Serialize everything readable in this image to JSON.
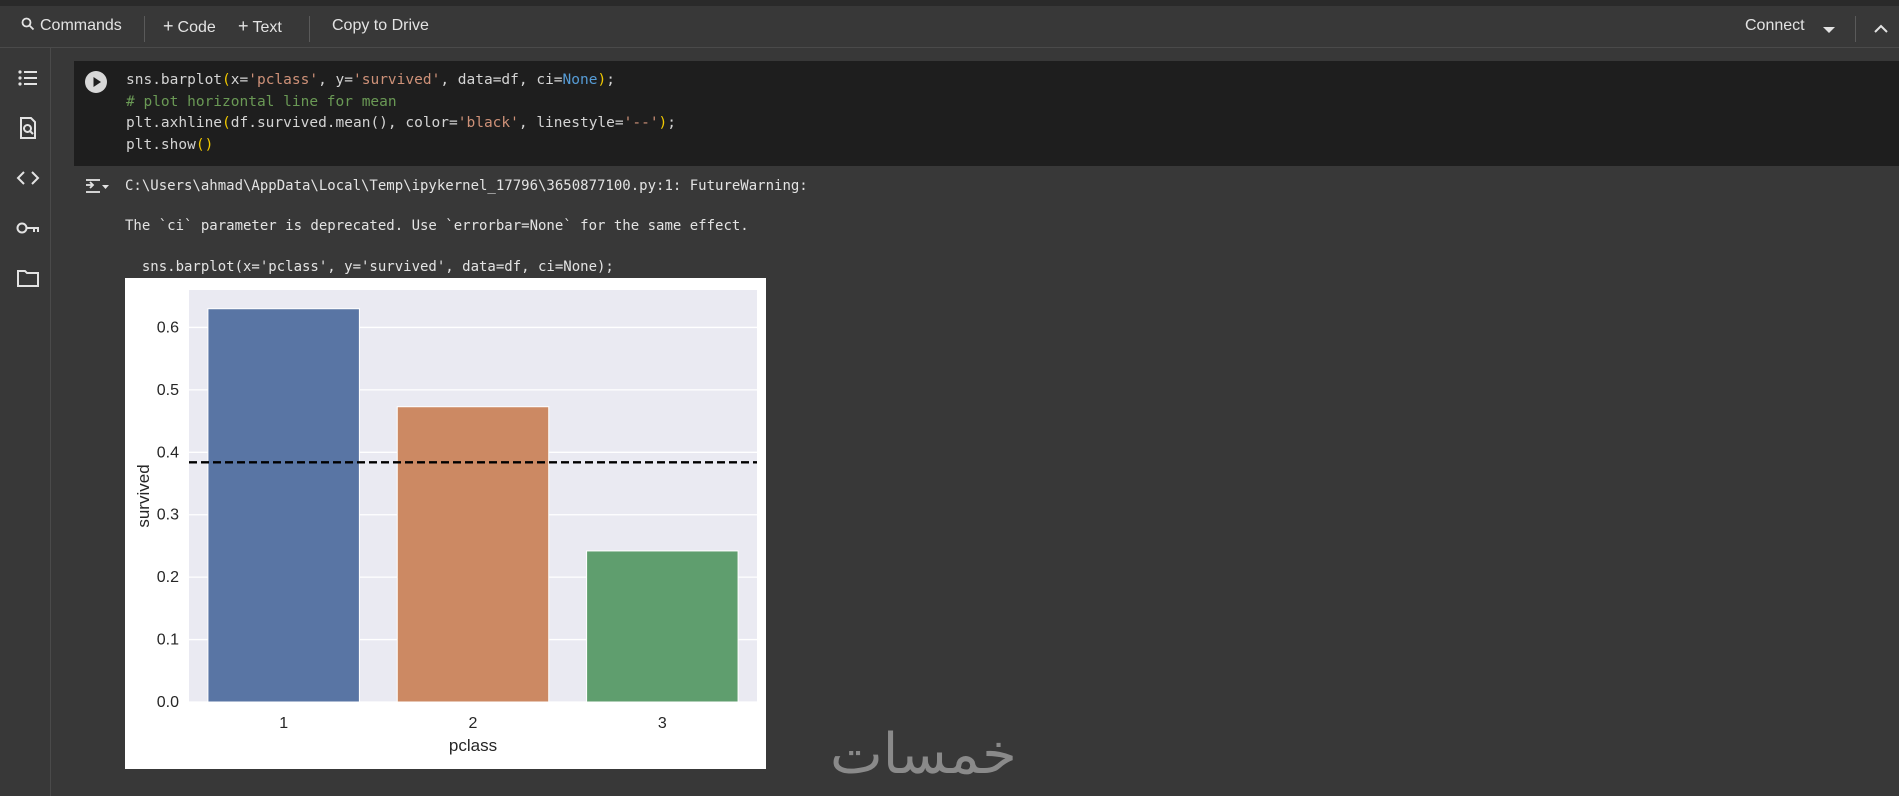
{
  "toolbar": {
    "commands_label": "Commands",
    "code_label": "Code",
    "text_label": "Text",
    "copy_label": "Copy to Drive",
    "connect_label": "Connect"
  },
  "cell": {
    "line1": {
      "a": "sns.barplot",
      "b": "(",
      "c": "x=",
      "d": "'pclass'",
      "e": ", y=",
      "f": "'survived'",
      "g": ", data=df, ci=",
      "h": "None",
      "i": ")",
      "j": ";"
    },
    "line2": "# plot horizontal line for mean",
    "line3": {
      "a": "plt.axhline",
      "b": "(",
      "c": "df.survived.mean(), color=",
      "d": "'black'",
      "e": ", linestyle=",
      "f": "'--'",
      "g": ")",
      "h": ";"
    },
    "line4": {
      "a": "plt.show",
      "b": "()"
    }
  },
  "output": {
    "warning_path": "C:\\Users\\ahmad\\AppData\\Local\\Temp\\ipykernel_17796\\3650877100.py:1: FutureWarning:",
    "warning_msg": "The `ci` parameter is deprecated. Use `errorbar=None` for the same effect.",
    "warning_code": "  sns.barplot(x='pclass', y='survived', data=df, ci=None);"
  },
  "chart_data": {
    "type": "bar",
    "categories": [
      "1",
      "2",
      "3"
    ],
    "values": [
      0.63,
      0.473,
      0.242
    ],
    "colors": [
      "#5975a4",
      "#cc8963",
      "#5f9e6e"
    ],
    "hline": 0.384,
    "hline_style": "dashed black",
    "xlabel": "pclass",
    "ylabel": "survived",
    "ylim": [
      0,
      0.66
    ],
    "yticks": [
      "0.0",
      "0.1",
      "0.2",
      "0.3",
      "0.4",
      "0.5",
      "0.6"
    ],
    "ytick_values": [
      0,
      0.1,
      0.2,
      0.3,
      0.4,
      0.5,
      0.6
    ],
    "grid": true,
    "background": "#eaeaf2"
  },
  "watermark": "خمسات"
}
